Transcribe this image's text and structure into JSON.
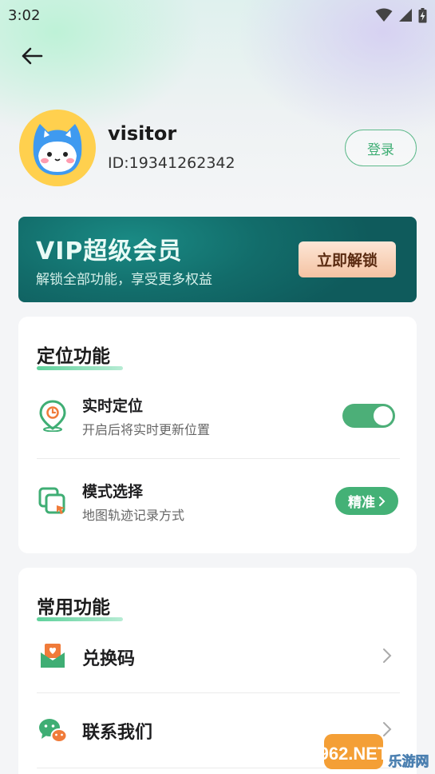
{
  "status_bar": {
    "time": "3:02"
  },
  "profile": {
    "username": "visitor",
    "user_id": "ID:19341262342",
    "login_label": "登录"
  },
  "vip": {
    "title": "VIP超级会员",
    "subtitle": "解锁全部功能，享受更多权益",
    "button_label": "立即解锁"
  },
  "location_section": {
    "title": "定位功能",
    "items": [
      {
        "title": "实时定位",
        "subtitle": "开启后将实时更新位置",
        "icon": "location-clock-icon",
        "toggle_on": true
      },
      {
        "title": "模式选择",
        "subtitle": "地图轨迹记录方式",
        "icon": "mode-select-icon",
        "value_label": "精准"
      }
    ]
  },
  "common_section": {
    "title": "常用功能",
    "items": [
      {
        "label": "兑换码",
        "icon": "redeem-code-icon"
      },
      {
        "label": "联系我们",
        "icon": "wechat-icon"
      }
    ]
  },
  "watermark": {
    "line1": "962.NET",
    "line2": "乐游网"
  },
  "colors": {
    "accent_green": "#4caf78",
    "vip_bg": "#126c6a",
    "vip_button": "#f4c3a3"
  }
}
